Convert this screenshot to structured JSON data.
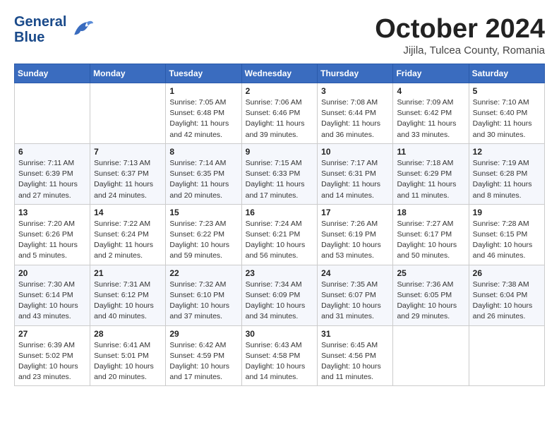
{
  "header": {
    "logo_line1": "General",
    "logo_line2": "Blue",
    "month": "October 2024",
    "location": "Jijila, Tulcea County, Romania"
  },
  "days_of_week": [
    "Sunday",
    "Monday",
    "Tuesday",
    "Wednesday",
    "Thursday",
    "Friday",
    "Saturday"
  ],
  "weeks": [
    [
      {
        "day": "",
        "info": ""
      },
      {
        "day": "",
        "info": ""
      },
      {
        "day": "1",
        "info": "Sunrise: 7:05 AM\nSunset: 6:48 PM\nDaylight: 11 hours and 42 minutes."
      },
      {
        "day": "2",
        "info": "Sunrise: 7:06 AM\nSunset: 6:46 PM\nDaylight: 11 hours and 39 minutes."
      },
      {
        "day": "3",
        "info": "Sunrise: 7:08 AM\nSunset: 6:44 PM\nDaylight: 11 hours and 36 minutes."
      },
      {
        "day": "4",
        "info": "Sunrise: 7:09 AM\nSunset: 6:42 PM\nDaylight: 11 hours and 33 minutes."
      },
      {
        "day": "5",
        "info": "Sunrise: 7:10 AM\nSunset: 6:40 PM\nDaylight: 11 hours and 30 minutes."
      }
    ],
    [
      {
        "day": "6",
        "info": "Sunrise: 7:11 AM\nSunset: 6:39 PM\nDaylight: 11 hours and 27 minutes."
      },
      {
        "day": "7",
        "info": "Sunrise: 7:13 AM\nSunset: 6:37 PM\nDaylight: 11 hours and 24 minutes."
      },
      {
        "day": "8",
        "info": "Sunrise: 7:14 AM\nSunset: 6:35 PM\nDaylight: 11 hours and 20 minutes."
      },
      {
        "day": "9",
        "info": "Sunrise: 7:15 AM\nSunset: 6:33 PM\nDaylight: 11 hours and 17 minutes."
      },
      {
        "day": "10",
        "info": "Sunrise: 7:17 AM\nSunset: 6:31 PM\nDaylight: 11 hours and 14 minutes."
      },
      {
        "day": "11",
        "info": "Sunrise: 7:18 AM\nSunset: 6:29 PM\nDaylight: 11 hours and 11 minutes."
      },
      {
        "day": "12",
        "info": "Sunrise: 7:19 AM\nSunset: 6:28 PM\nDaylight: 11 hours and 8 minutes."
      }
    ],
    [
      {
        "day": "13",
        "info": "Sunrise: 7:20 AM\nSunset: 6:26 PM\nDaylight: 11 hours and 5 minutes."
      },
      {
        "day": "14",
        "info": "Sunrise: 7:22 AM\nSunset: 6:24 PM\nDaylight: 11 hours and 2 minutes."
      },
      {
        "day": "15",
        "info": "Sunrise: 7:23 AM\nSunset: 6:22 PM\nDaylight: 10 hours and 59 minutes."
      },
      {
        "day": "16",
        "info": "Sunrise: 7:24 AM\nSunset: 6:21 PM\nDaylight: 10 hours and 56 minutes."
      },
      {
        "day": "17",
        "info": "Sunrise: 7:26 AM\nSunset: 6:19 PM\nDaylight: 10 hours and 53 minutes."
      },
      {
        "day": "18",
        "info": "Sunrise: 7:27 AM\nSunset: 6:17 PM\nDaylight: 10 hours and 50 minutes."
      },
      {
        "day": "19",
        "info": "Sunrise: 7:28 AM\nSunset: 6:15 PM\nDaylight: 10 hours and 46 minutes."
      }
    ],
    [
      {
        "day": "20",
        "info": "Sunrise: 7:30 AM\nSunset: 6:14 PM\nDaylight: 10 hours and 43 minutes."
      },
      {
        "day": "21",
        "info": "Sunrise: 7:31 AM\nSunset: 6:12 PM\nDaylight: 10 hours and 40 minutes."
      },
      {
        "day": "22",
        "info": "Sunrise: 7:32 AM\nSunset: 6:10 PM\nDaylight: 10 hours and 37 minutes."
      },
      {
        "day": "23",
        "info": "Sunrise: 7:34 AM\nSunset: 6:09 PM\nDaylight: 10 hours and 34 minutes."
      },
      {
        "day": "24",
        "info": "Sunrise: 7:35 AM\nSunset: 6:07 PM\nDaylight: 10 hours and 31 minutes."
      },
      {
        "day": "25",
        "info": "Sunrise: 7:36 AM\nSunset: 6:05 PM\nDaylight: 10 hours and 29 minutes."
      },
      {
        "day": "26",
        "info": "Sunrise: 7:38 AM\nSunset: 6:04 PM\nDaylight: 10 hours and 26 minutes."
      }
    ],
    [
      {
        "day": "27",
        "info": "Sunrise: 6:39 AM\nSunset: 5:02 PM\nDaylight: 10 hours and 23 minutes."
      },
      {
        "day": "28",
        "info": "Sunrise: 6:41 AM\nSunset: 5:01 PM\nDaylight: 10 hours and 20 minutes."
      },
      {
        "day": "29",
        "info": "Sunrise: 6:42 AM\nSunset: 4:59 PM\nDaylight: 10 hours and 17 minutes."
      },
      {
        "day": "30",
        "info": "Sunrise: 6:43 AM\nSunset: 4:58 PM\nDaylight: 10 hours and 14 minutes."
      },
      {
        "day": "31",
        "info": "Sunrise: 6:45 AM\nSunset: 4:56 PM\nDaylight: 10 hours and 11 minutes."
      },
      {
        "day": "",
        "info": ""
      },
      {
        "day": "",
        "info": ""
      }
    ]
  ]
}
